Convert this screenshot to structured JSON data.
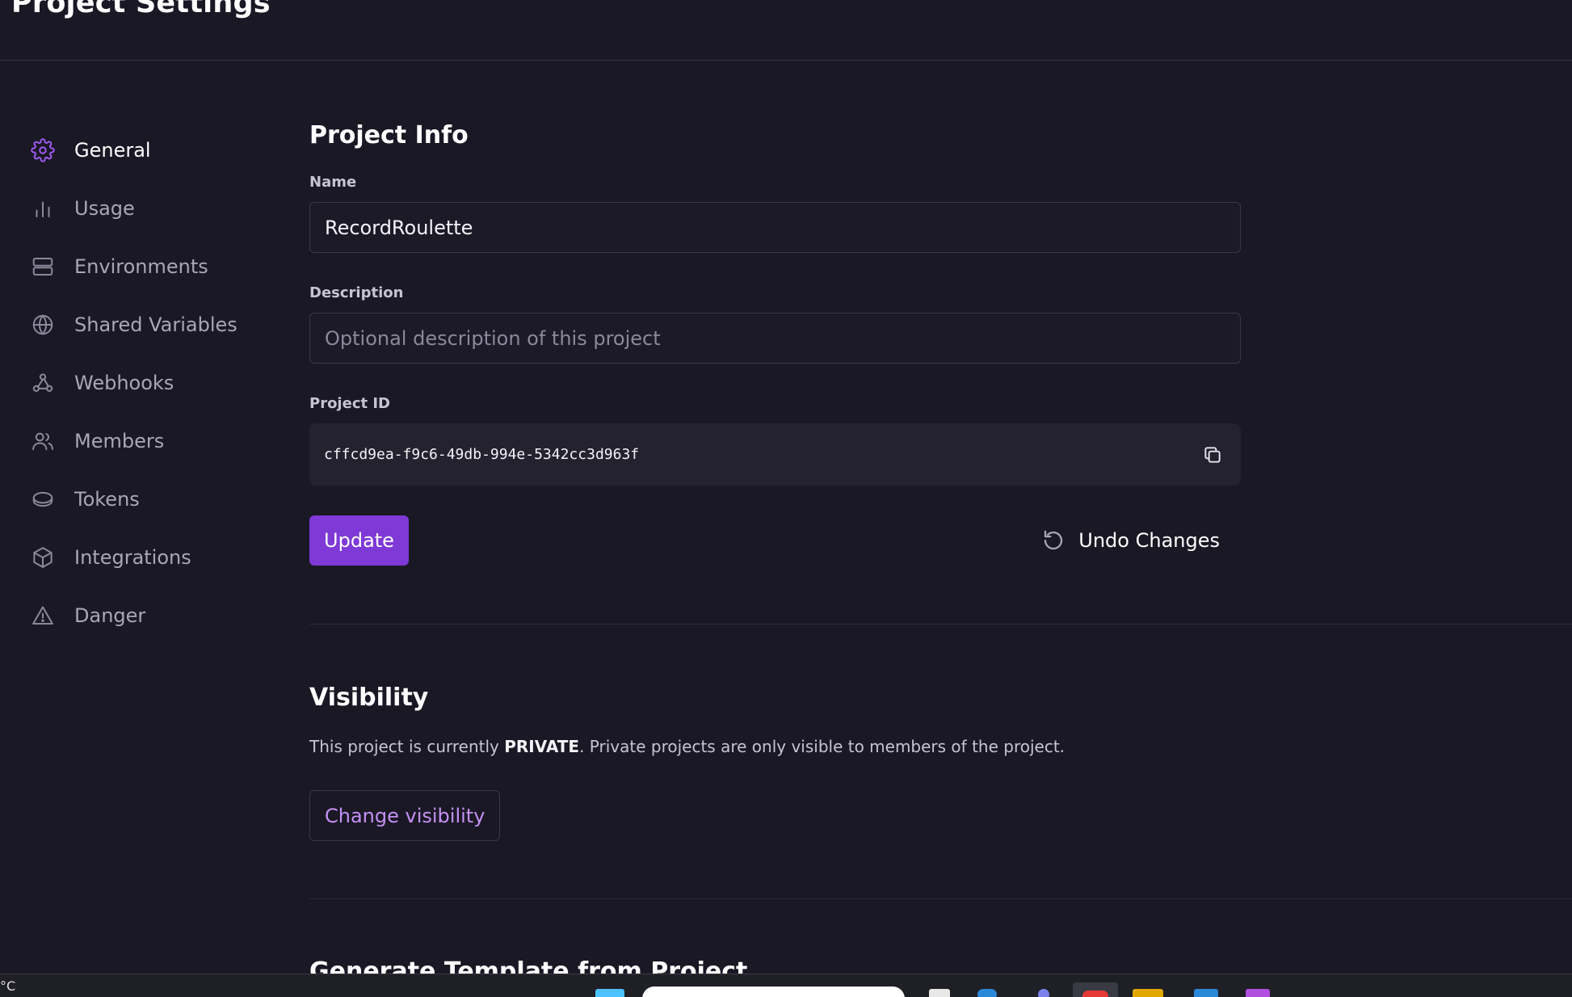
{
  "page": {
    "title": "Project Settings"
  },
  "sidebar": {
    "items": [
      {
        "label": "General",
        "icon": "gear-icon",
        "active": true
      },
      {
        "label": "Usage",
        "icon": "bar-chart-icon",
        "active": false
      },
      {
        "label": "Environments",
        "icon": "server-icon",
        "active": false
      },
      {
        "label": "Shared Variables",
        "icon": "globe-icon",
        "active": false
      },
      {
        "label": "Webhooks",
        "icon": "webhook-icon",
        "active": false
      },
      {
        "label": "Members",
        "icon": "users-icon",
        "active": false
      },
      {
        "label": "Tokens",
        "icon": "coin-icon",
        "active": false
      },
      {
        "label": "Integrations",
        "icon": "cube-icon",
        "active": false
      },
      {
        "label": "Danger",
        "icon": "warning-icon",
        "active": false
      }
    ]
  },
  "project_info": {
    "title": "Project Info",
    "name_label": "Name",
    "name_value": "RecordRoulette",
    "description_label": "Description",
    "description_placeholder": "Optional description of this project",
    "description_value": "",
    "project_id_label": "Project ID",
    "project_id_value": "cffcd9ea-f9c6-49db-994e-5342cc3d963f",
    "update_label": "Update",
    "undo_label": "Undo Changes"
  },
  "visibility": {
    "title": "Visibility",
    "text_before": "This project is currently ",
    "status": "PRIVATE",
    "text_after": ". Private projects are only visible to members of the project.",
    "change_button_label": "Change visibility"
  },
  "template": {
    "title": "Generate Template from Project"
  },
  "taskbar": {
    "temperature": "°C"
  },
  "colors": {
    "background": "#1a1825",
    "accent": "#7e39d6",
    "accent_text": "#c590f5",
    "input_border": "#3a3747"
  }
}
